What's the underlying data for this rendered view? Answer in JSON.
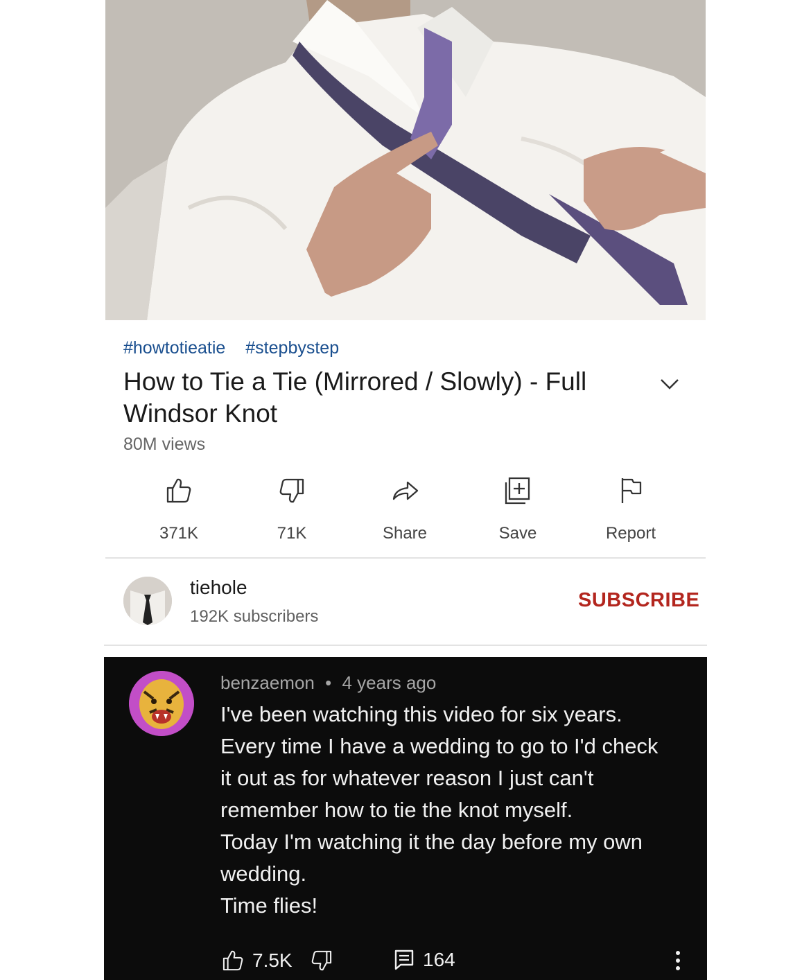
{
  "video": {
    "hashtags": [
      "#howtotieatie",
      "#stepbystep"
    ],
    "title": "How to Tie a Tie (Mirrored / Slowly) - Full Windsor Knot",
    "views": "80M views"
  },
  "actions": {
    "like": {
      "label": "371K",
      "icon": "thumb-up-icon"
    },
    "dislike": {
      "label": "71K",
      "icon": "thumb-down-icon"
    },
    "share": {
      "label": "Share",
      "icon": "share-icon"
    },
    "save": {
      "label": "Save",
      "icon": "save-playlist-icon"
    },
    "report": {
      "label": "Report",
      "icon": "flag-icon"
    }
  },
  "channel": {
    "name": "tiehole",
    "subscribers": "192K subscribers",
    "subscribe_label": "SUBSCRIBE",
    "subscribe_color": "#b3261e"
  },
  "comment": {
    "author": "benzaemon",
    "separator": "•",
    "time": "4 years ago",
    "lines": [
      "I've been watching this video for six years.",
      "Every time I have a wedding to go to I'd check",
      "it out as for whatever reason I just can't",
      "remember how to tie the knot myself.",
      "Today I'm watching it the day before my own",
      "wedding.",
      "Time flies!"
    ],
    "likes": "7.5K",
    "replies": "164",
    "background": "#0c0c0c",
    "avatar_color": "#c24ec7"
  }
}
